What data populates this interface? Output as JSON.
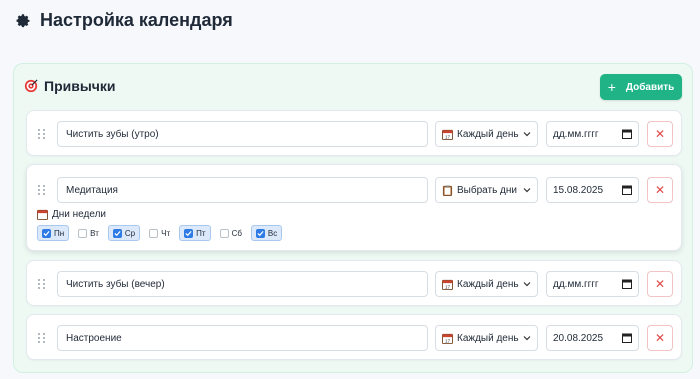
{
  "header": {
    "title": "Настройка календаря",
    "icon": "gear-icon"
  },
  "habits_section": {
    "title": "Привычки",
    "icon": "target-icon",
    "add_button": {
      "label": "Добавить",
      "icon": "plus-icon"
    }
  },
  "habits": [
    {
      "name": "Чистить зубы (утро)",
      "frequency": "Каждый день",
      "date": "дд.мм.гггг"
    },
    {
      "name": "Медитация",
      "frequency": "Выбрать дни",
      "date": "15.08.2025",
      "days_label": "Дни недели",
      "days": [
        {
          "label": "Пн",
          "checked": true
        },
        {
          "label": "Вт",
          "checked": false
        },
        {
          "label": "Ср",
          "checked": true
        },
        {
          "label": "Чт",
          "checked": false
        },
        {
          "label": "Пт",
          "checked": true
        },
        {
          "label": "Сб",
          "checked": false
        },
        {
          "label": "Вс",
          "checked": true
        }
      ]
    },
    {
      "name": "Чистить зубы (вечер)",
      "frequency": "Каждый день",
      "date": "дд.мм.гггг"
    },
    {
      "name": "Настроение",
      "frequency": "Каждый день",
      "date": "20.08.2025"
    }
  ],
  "delete_symbol": "✕",
  "colors": {
    "accent": "#1fb386",
    "danger": "#e04848",
    "checkbox": "#2f7be6"
  }
}
